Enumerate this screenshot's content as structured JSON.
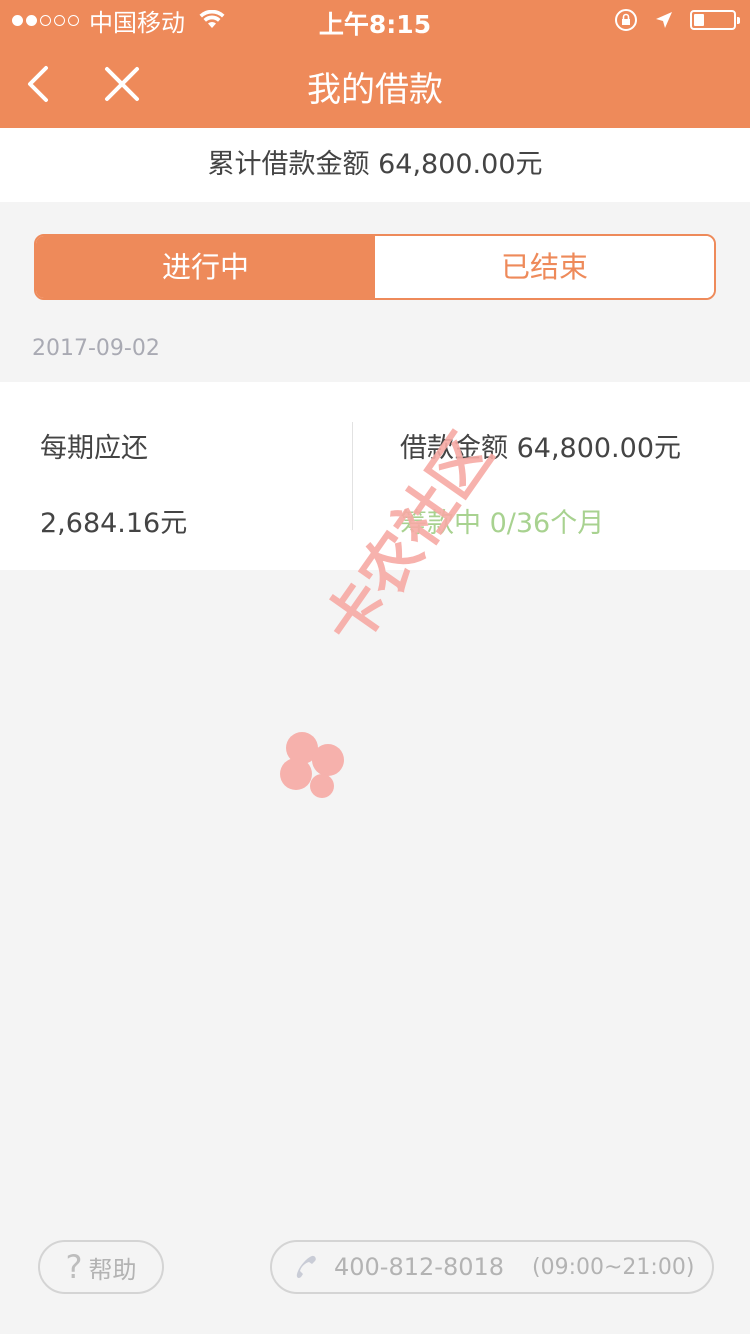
{
  "status_bar": {
    "carrier": "中国移动",
    "time": "上午8:15",
    "battery_level": 0.25
  },
  "nav": {
    "title": "我的借款",
    "back_icon": "chevron-left-icon",
    "close_icon": "close-icon"
  },
  "summary": {
    "total_label": "累计借款金额 64,800.00元"
  },
  "tabs": [
    {
      "label": "进行中",
      "active": true
    },
    {
      "label": "已结束",
      "active": false
    }
  ],
  "loans": [
    {
      "date": "2017-09-02",
      "installment_label": "每期应还",
      "installment_amount": "2,684.16元",
      "loan_amount_label": "借款金额 64,800.00元",
      "status": "筹款中 0/36个月"
    }
  ],
  "watermark": {
    "text": "卡农社区"
  },
  "footer": {
    "help_label": "帮助",
    "phone_number": "400-812-8018",
    "hours": "(09:00~21:00)"
  },
  "colors": {
    "brand": "#ee8a5a",
    "status_green": "#a8d290",
    "background": "#f4f4f4"
  }
}
